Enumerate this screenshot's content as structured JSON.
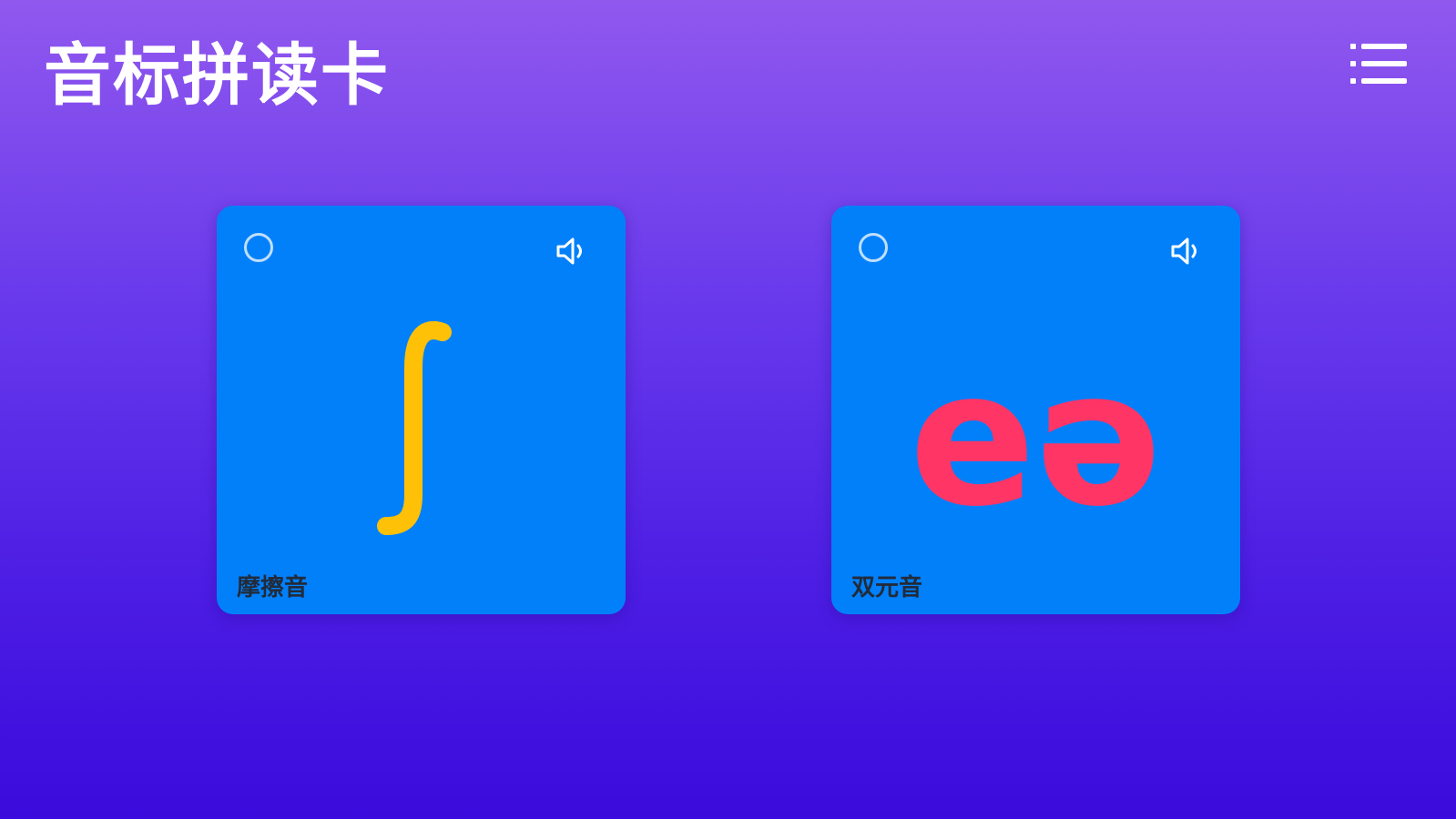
{
  "header": {
    "title": "音标拼读卡",
    "menu_icon": "list-menu-icon"
  },
  "cards": [
    {
      "symbol": "ʃ",
      "category": "摩擦音",
      "symbol_color": "#ffc107",
      "check_icon": "circle-outline-icon",
      "sound_icon": "speaker-icon"
    },
    {
      "symbol": "eə",
      "category": "双元音",
      "symbol_color": "#ff3566",
      "check_icon": "circle-outline-icon",
      "sound_icon": "speaker-icon"
    }
  ],
  "colors": {
    "card_background": "#0280fa",
    "bg_top": "#9158ee",
    "bg_bottom": "#3a0bdc",
    "title": "#ffffff"
  }
}
